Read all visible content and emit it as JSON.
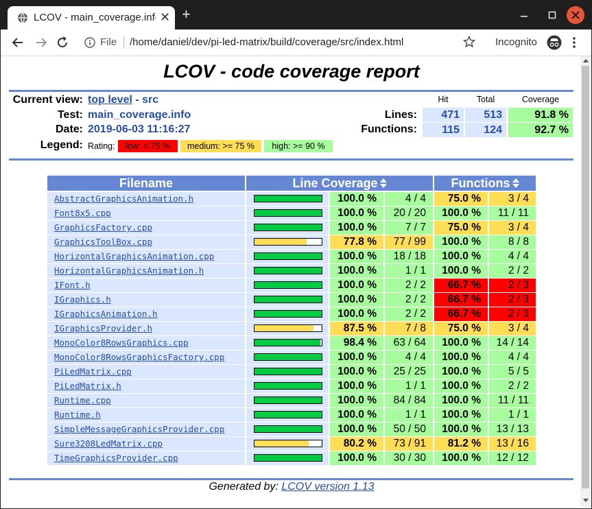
{
  "browser": {
    "tab_title": "LCOV - main_coverage.info",
    "new_tab_symbol": "+",
    "file_label": "File",
    "url": "/home/daniel/dev/pi-led-matrix/build/coverage/src/index.html",
    "incognito_label": "Incognito"
  },
  "report": {
    "title": "LCOV - code coverage report",
    "current_view_label": "Current view:",
    "current_view_link": "top level",
    "current_view_sep": " - ",
    "current_view_dir": "src",
    "test_label": "Test:",
    "test_value": "main_coverage.info",
    "date_label": "Date:",
    "date_value": "2019-06-03 11:16:27",
    "legend_label": "Legend:",
    "rating_label": "Rating:",
    "legend_low": "low: < 75 %",
    "legend_medium": "medium: >= 75 %",
    "legend_high": "high: >= 90 %",
    "col_hit": "Hit",
    "col_total": "Total",
    "col_coverage": "Coverage",
    "lines_label": "Lines:",
    "lines_hit": "471",
    "lines_total": "513",
    "lines_cov": "91.8 %",
    "functions_label": "Functions:",
    "functions_hit": "115",
    "functions_total": "124",
    "functions_cov": "92.7 %"
  },
  "colors": {
    "low": "#ff0000",
    "medium": "#ffdd55",
    "high": "#a7fc9d",
    "bar_good": "#00cc44",
    "bar_medium": "#ffdd55"
  },
  "table": {
    "headers": {
      "filename": "Filename",
      "line_coverage": "Line Coverage",
      "functions": "Functions"
    },
    "rows": [
      {
        "file": "AbstractGraphicsAnimation.h",
        "line_pct": "100.0 %",
        "line_count": "4 / 4",
        "line_fraction": 1.0,
        "line_rating": "high",
        "func_pct": "75.0 %",
        "func_count": "3 / 4",
        "func_rating": "medium"
      },
      {
        "file": "Font8x5.cpp",
        "line_pct": "100.0 %",
        "line_count": "20 / 20",
        "line_fraction": 1.0,
        "line_rating": "high",
        "func_pct": "100.0 %",
        "func_count": "11 / 11",
        "func_rating": "high"
      },
      {
        "file": "GraphicsFactory.cpp",
        "line_pct": "100.0 %",
        "line_count": "7 / 7",
        "line_fraction": 1.0,
        "line_rating": "high",
        "func_pct": "75.0 %",
        "func_count": "3 / 4",
        "func_rating": "medium"
      },
      {
        "file": "GraphicsToolBox.cpp",
        "line_pct": "77.8 %",
        "line_count": "77 / 99",
        "line_fraction": 0.778,
        "line_rating": "medium",
        "func_pct": "100.0 %",
        "func_count": "8 / 8",
        "func_rating": "high"
      },
      {
        "file": "HorizontalGraphicsAnimation.cpp",
        "line_pct": "100.0 %",
        "line_count": "18 / 18",
        "line_fraction": 1.0,
        "line_rating": "high",
        "func_pct": "100.0 %",
        "func_count": "4 / 4",
        "func_rating": "high"
      },
      {
        "file": "HorizontalGraphicsAnimation.h",
        "line_pct": "100.0 %",
        "line_count": "1 / 1",
        "line_fraction": 1.0,
        "line_rating": "high",
        "func_pct": "100.0 %",
        "func_count": "2 / 2",
        "func_rating": "high"
      },
      {
        "file": "IFont.h",
        "line_pct": "100.0 %",
        "line_count": "2 / 2",
        "line_fraction": 1.0,
        "line_rating": "high",
        "func_pct": "66.7 %",
        "func_count": "2 / 3",
        "func_rating": "low"
      },
      {
        "file": "IGraphics.h",
        "line_pct": "100.0 %",
        "line_count": "2 / 2",
        "line_fraction": 1.0,
        "line_rating": "high",
        "func_pct": "66.7 %",
        "func_count": "2 / 3",
        "func_rating": "low"
      },
      {
        "file": "IGraphicsAnimation.h",
        "line_pct": "100.0 %",
        "line_count": "2 / 2",
        "line_fraction": 1.0,
        "line_rating": "high",
        "func_pct": "66.7 %",
        "func_count": "2 / 3",
        "func_rating": "low"
      },
      {
        "file": "IGraphicsProvider.h",
        "line_pct": "87.5 %",
        "line_count": "7 / 8",
        "line_fraction": 0.875,
        "line_rating": "medium",
        "func_pct": "75.0 %",
        "func_count": "3 / 4",
        "func_rating": "medium"
      },
      {
        "file": "MonoColor8RowsGraphics.cpp",
        "line_pct": "98.4 %",
        "line_count": "63 / 64",
        "line_fraction": 0.984,
        "line_rating": "high",
        "func_pct": "100.0 %",
        "func_count": "14 / 14",
        "func_rating": "high"
      },
      {
        "file": "MonoColor8RowsGraphicsFactory.cpp",
        "line_pct": "100.0 %",
        "line_count": "4 / 4",
        "line_fraction": 1.0,
        "line_rating": "high",
        "func_pct": "100.0 %",
        "func_count": "4 / 4",
        "func_rating": "high"
      },
      {
        "file": "PiLedMatrix.cpp",
        "line_pct": "100.0 %",
        "line_count": "25 / 25",
        "line_fraction": 1.0,
        "line_rating": "high",
        "func_pct": "100.0 %",
        "func_count": "5 / 5",
        "func_rating": "high"
      },
      {
        "file": "PiLedMatrix.h",
        "line_pct": "100.0 %",
        "line_count": "1 / 1",
        "line_fraction": 1.0,
        "line_rating": "high",
        "func_pct": "100.0 %",
        "func_count": "2 / 2",
        "func_rating": "high"
      },
      {
        "file": "Runtime.cpp",
        "line_pct": "100.0 %",
        "line_count": "84 / 84",
        "line_fraction": 1.0,
        "line_rating": "high",
        "func_pct": "100.0 %",
        "func_count": "11 / 11",
        "func_rating": "high"
      },
      {
        "file": "Runtime.h",
        "line_pct": "100.0 %",
        "line_count": "1 / 1",
        "line_fraction": 1.0,
        "line_rating": "high",
        "func_pct": "100.0 %",
        "func_count": "1 / 1",
        "func_rating": "high"
      },
      {
        "file": "SimpleMessageGraphicsProvider.cpp",
        "line_pct": "100.0 %",
        "line_count": "50 / 50",
        "line_fraction": 1.0,
        "line_rating": "high",
        "func_pct": "100.0 %",
        "func_count": "13 / 13",
        "func_rating": "high"
      },
      {
        "file": "Sure3208LedMatrix.cpp",
        "line_pct": "80.2 %",
        "line_count": "73 / 91",
        "line_fraction": 0.802,
        "line_rating": "medium",
        "func_pct": "81.2 %",
        "func_count": "13 / 16",
        "func_rating": "medium"
      },
      {
        "file": "TimeGraphicsProvider.cpp",
        "line_pct": "100.0 %",
        "line_count": "30 / 30",
        "line_fraction": 1.0,
        "line_rating": "high",
        "func_pct": "100.0 %",
        "func_count": "12 / 12",
        "func_rating": "high"
      }
    ]
  },
  "footer": {
    "generated_by": "Generated by: ",
    "link": "LCOV version 1.13"
  }
}
